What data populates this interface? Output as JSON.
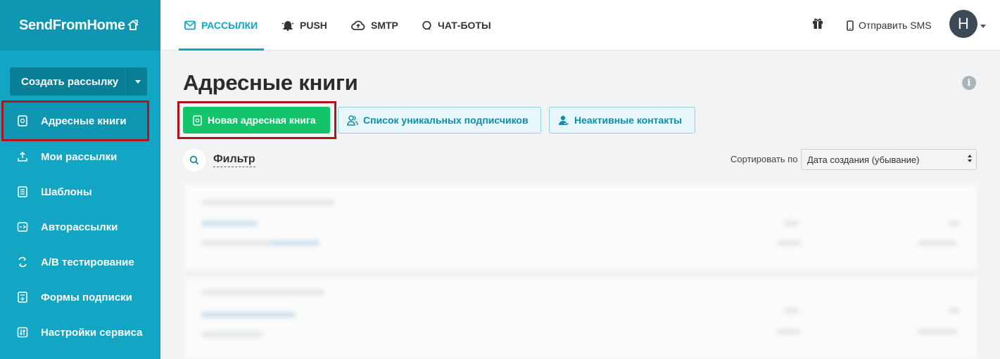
{
  "logo": {
    "text": "SendFromHome"
  },
  "sidebar": {
    "create_button": "Создать рассылку",
    "items": [
      {
        "label": "Адресные книги",
        "icon": "address-book-icon",
        "active": true
      },
      {
        "label": "Мои рассылки",
        "icon": "upload-icon"
      },
      {
        "label": "Шаблоны",
        "icon": "template-icon"
      },
      {
        "label": "Авторассылки",
        "icon": "automation-icon"
      },
      {
        "label": "A/B тестирование",
        "icon": "ab-test-icon"
      },
      {
        "label": "Формы подписки",
        "icon": "form-icon"
      },
      {
        "label": "Настройки сервиса",
        "icon": "settings-icon"
      }
    ]
  },
  "topbar": {
    "tabs": [
      {
        "label": "РАССЫЛКИ",
        "icon": "mail-icon",
        "active": true
      },
      {
        "label": "PUSH",
        "icon": "bell-icon"
      },
      {
        "label": "SMTP",
        "icon": "cloud-icon"
      },
      {
        "label": "ЧАТ-БОТЫ",
        "icon": "chat-icon"
      }
    ],
    "sms_label": "Отправить SMS",
    "avatar_initial": "Н"
  },
  "main": {
    "title": "Адресные книги",
    "buttons": {
      "new_book": "Новая адресная книга",
      "unique_subscribers": "Список уникальных подписчиков",
      "inactive_contacts": "Неактивные контакты"
    },
    "filter_label": "Фильтр",
    "sort_label": "Сортировать по",
    "sort_value": "Дата создания (убывание)"
  },
  "colors": {
    "sidebar": "#12a6c4",
    "accent": "#12a6c4",
    "green_button": "#14c46b",
    "highlight": "#b3121c"
  }
}
